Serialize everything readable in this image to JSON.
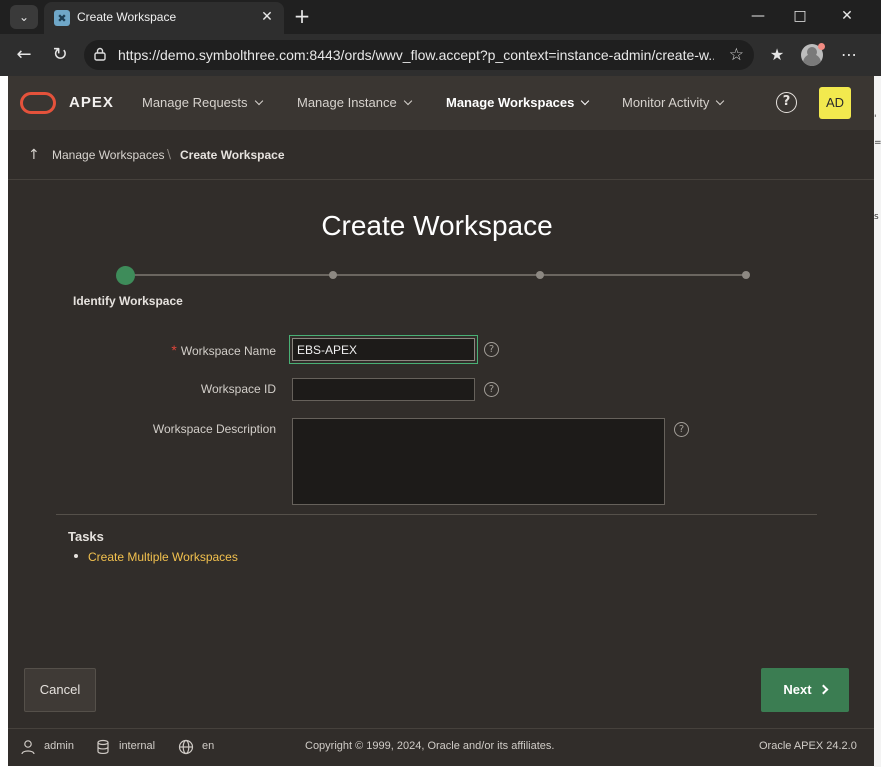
{
  "browser": {
    "tab_title": "Create Workspace",
    "url": "https://demo.symbolthree.com:8443/ords/wwv_flow.accept?p_context=instance-admin/create-w..."
  },
  "header": {
    "logo_text": "APEX",
    "menu": [
      {
        "label": "Manage Requests"
      },
      {
        "label": "Manage Instance"
      },
      {
        "label": "Manage Workspaces"
      },
      {
        "label": "Monitor Activity"
      }
    ],
    "help": "?",
    "avatar": "AD"
  },
  "breadcrumb": {
    "parent": "Manage Workspaces",
    "current": "Create Workspace"
  },
  "page": {
    "title": "Create Workspace"
  },
  "wizard": {
    "current_step_label": "Identify Workspace",
    "total_steps": 4,
    "current_step": 1
  },
  "form": {
    "workspace_name": {
      "label": "Workspace Name",
      "value": "EBS-APEX"
    },
    "workspace_id": {
      "label": "Workspace ID",
      "value": ""
    },
    "workspace_description": {
      "label": "Workspace Description",
      "value": ""
    }
  },
  "tasks": {
    "title": "Tasks",
    "items": [
      "Create Multiple Workspaces"
    ]
  },
  "buttons": {
    "cancel": "Cancel",
    "next": "Next"
  },
  "footer": {
    "user": "admin",
    "workspace": "internal",
    "language": "en",
    "copyright": "Copyright © 1999, 2024, Oracle and/or its affiliates.",
    "version": "Oracle APEX 24.2.0"
  },
  "colors": {
    "accent_green": "#3b7d52",
    "link_yellow": "#f2c14e",
    "logo_red": "#e4523b",
    "avatar_yellow": "#f2e94e"
  }
}
